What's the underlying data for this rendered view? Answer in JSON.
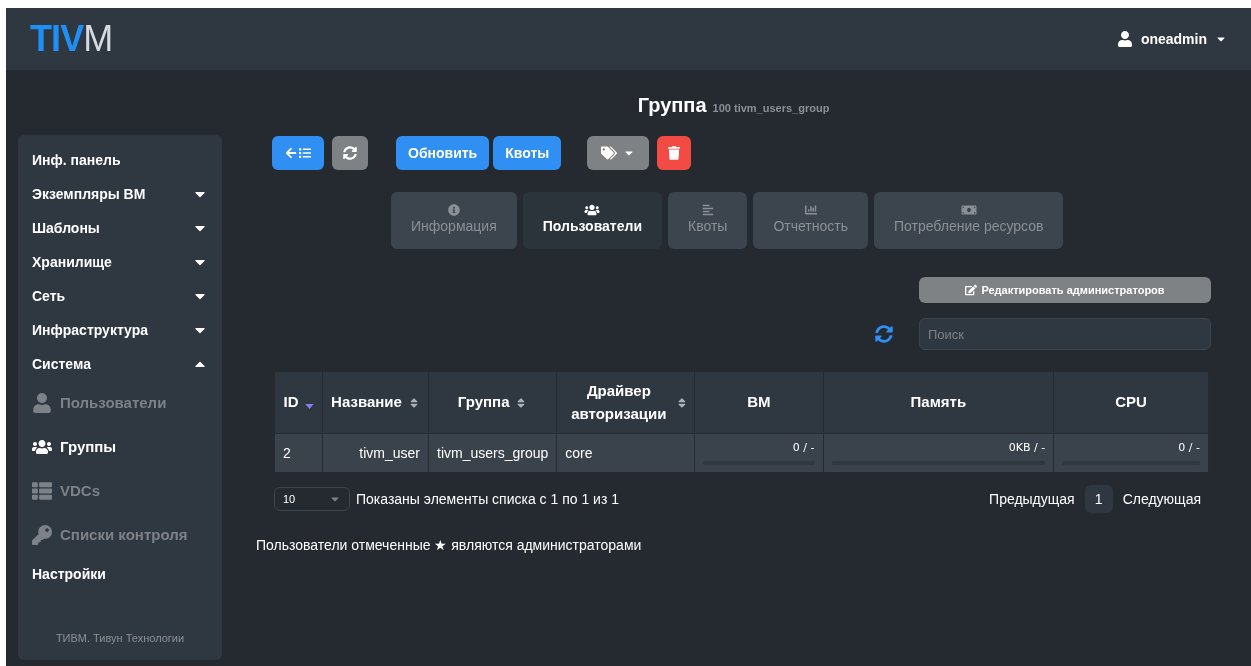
{
  "header": {
    "logo_bold": "TIV",
    "logo_light": "M",
    "user": "oneadmin"
  },
  "sidebar": {
    "items": [
      {
        "label": "Инф. панель",
        "kind": "plain"
      },
      {
        "label": "Экземпляры ВМ",
        "kind": "group",
        "expanded": false
      },
      {
        "label": "Шаблоны",
        "kind": "group",
        "expanded": false
      },
      {
        "label": "Хранилище",
        "kind": "group",
        "expanded": false
      },
      {
        "label": "Сеть",
        "kind": "group",
        "expanded": false
      },
      {
        "label": "Инфраструктура",
        "kind": "group",
        "expanded": false
      },
      {
        "label": "Система",
        "kind": "group",
        "expanded": true,
        "children": [
          {
            "label": "Пользователи",
            "selected": false
          },
          {
            "label": "Группы",
            "selected": true
          },
          {
            "label": "VDCs",
            "selected": false
          },
          {
            "label": "Списки контроля",
            "selected": false
          }
        ]
      },
      {
        "label": "Настройки",
        "kind": "plain"
      }
    ],
    "footer": "ТИВМ. Тивун Технологии"
  },
  "title": {
    "label": "Группа",
    "subtitle": "100 tivm_users_group"
  },
  "toolbar": [
    {
      "kind": "back"
    },
    {
      "kind": "refresh"
    },
    {
      "kind": "text",
      "label": "Обновить"
    },
    {
      "kind": "text",
      "label": "Квоты"
    },
    {
      "kind": "labels"
    },
    {
      "kind": "delete"
    }
  ],
  "tabs": [
    {
      "label": "Информация",
      "selected": false
    },
    {
      "label": "Пользователи",
      "selected": true
    },
    {
      "label": "Квоты",
      "selected": false
    },
    {
      "label": "Отчетность",
      "selected": false
    },
    {
      "label": "Потребление ресурсов",
      "selected": false
    }
  ],
  "edit_admins_button": "Редактировать администраторов",
  "search": {
    "placeholder": "Поиск"
  },
  "table": {
    "columns": [
      {
        "label": "ID",
        "kind": "sorted"
      },
      {
        "label": "Название",
        "kind": "sortable"
      },
      {
        "label": "Группа",
        "kind": "sortable"
      },
      {
        "label": "Драйвер авторизации",
        "kind": "sortable"
      },
      {
        "label": "ВМ",
        "kind": "plain"
      },
      {
        "label": "Память",
        "kind": "plain"
      },
      {
        "label": "CPU",
        "kind": "plain"
      }
    ],
    "rows": [
      {
        "cells": [
          "2",
          "tivm_user",
          "tivm_users_group",
          "core"
        ],
        "quotas": [
          {
            "reading": "0 / -",
            "level": 0
          },
          {
            "reading": "0KB / -",
            "level": 0
          },
          {
            "reading": "0 / -",
            "level": 0
          }
        ]
      }
    ]
  },
  "pagination": {
    "page_size": "10",
    "info": "Показаны элементы списка с 1 по 1 из 1",
    "previous": "Предыдущая",
    "pages": [
      {
        "label": "1",
        "selected": true
      }
    ],
    "next": "Следующая"
  },
  "note": "Пользователи отмеченные ★ являются администраторами"
}
